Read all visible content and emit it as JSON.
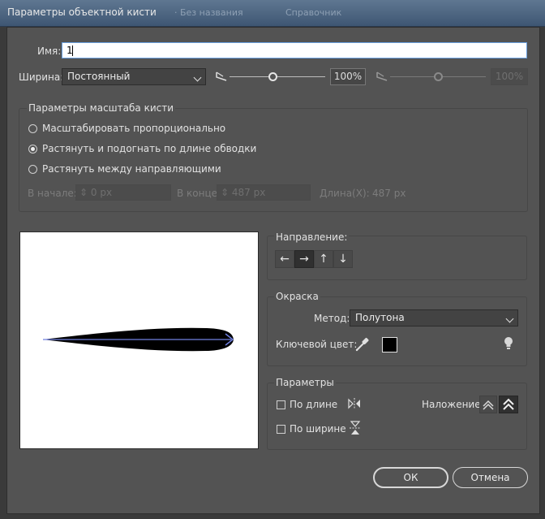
{
  "window": {
    "title": "Параметры объектной кисти",
    "ghost_text_1": "· Без названия",
    "ghost_text_2": "Справочник"
  },
  "name_field": {
    "label": "Имя:",
    "value": "1"
  },
  "width": {
    "label": "Ширина:",
    "selected": "Постоянный",
    "value_pct": "100%",
    "value2_pct": "100%",
    "slider1_level": 0.45,
    "slider2_level": 0.5
  },
  "scale_options": {
    "title": "Параметры масштаба кисти",
    "options": [
      {
        "label": "Масштабировать пропорционально",
        "checked": false
      },
      {
        "label": "Растянуть и подогнать по длине обводки",
        "checked": true
      },
      {
        "label": "Растянуть между направляющими",
        "checked": false
      }
    ],
    "start_label": "В начале:",
    "start_value": "0 px",
    "end_label": "В конце:",
    "end_value": "487 px",
    "length_label": "Длина(X):",
    "length_value": "487 px"
  },
  "direction": {
    "title": "Направление:",
    "buttons": [
      {
        "glyph": "←",
        "icon": "arrow-left-icon",
        "active": false
      },
      {
        "glyph": "→",
        "icon": "arrow-right-icon",
        "active": true
      },
      {
        "glyph": "↑",
        "icon": "arrow-up-icon",
        "active": false
      },
      {
        "glyph": "↓",
        "icon": "arrow-down-icon",
        "active": false
      }
    ]
  },
  "colorization": {
    "title": "Окраска",
    "method_label": "Метод:",
    "method_value": "Полутона",
    "key_color_label": "Ключевой цвет:",
    "key_color": "#000000"
  },
  "options": {
    "title": "Параметры",
    "flip_along_label": "По длине",
    "flip_across_label": "По ширине",
    "overlap_label": "Наложение:"
  },
  "buttons": {
    "ok": "ОК",
    "cancel": "Отмена"
  },
  "colors": {
    "dialog_bg": "#535353",
    "stroke_path": "#6f7fe0",
    "brush_fill": "#000000"
  }
}
